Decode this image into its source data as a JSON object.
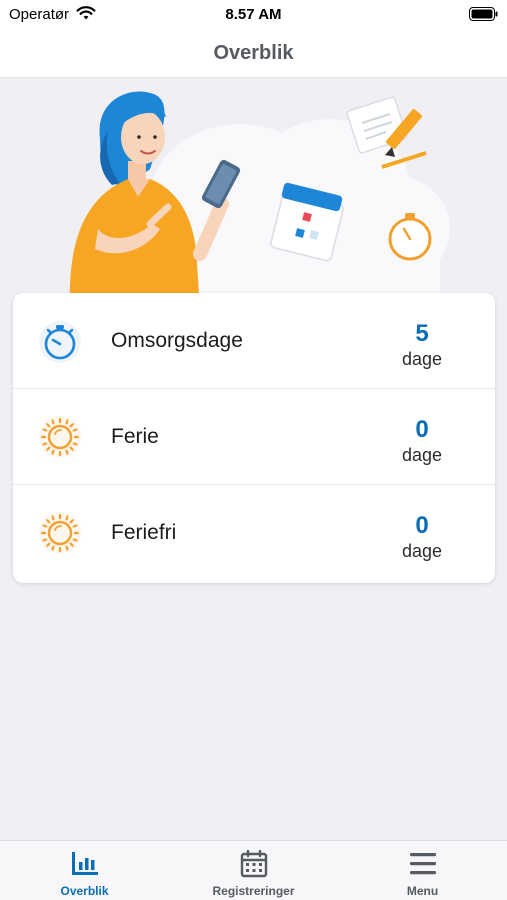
{
  "status_bar": {
    "carrier": "Operatør",
    "time": "8.57 AM",
    "wifi_icon": "wifi-icon",
    "battery_icon": "battery-full-icon"
  },
  "nav": {
    "title": "Overblik"
  },
  "hero": {
    "illustration": "woman-with-phone-calendar-stopwatch-illustration",
    "colors": {
      "hair": "#1d86d6",
      "shirt": "#f6a623",
      "cloud": "#f7f7f9"
    }
  },
  "overview": {
    "items": [
      {
        "label": "Omsorgsdage",
        "value": "5",
        "unit": "dage",
        "icon": "stopwatch-icon"
      },
      {
        "label": "Ferie",
        "value": "0",
        "unit": "dage",
        "icon": "sun-icon"
      },
      {
        "label": "Feriefri",
        "value": "0",
        "unit": "dage",
        "icon": "sun-icon"
      }
    ],
    "value_color": "#0a6eb4",
    "icon_color_stopwatch": "#1d86d6",
    "icon_color_sun": "#f0a030"
  },
  "tabs": [
    {
      "label": "Overblik",
      "icon": "bar-chart-icon",
      "active": true
    },
    {
      "label": "Registreringer",
      "icon": "calendar-icon",
      "active": false
    },
    {
      "label": "Menu",
      "icon": "hamburger-menu-icon",
      "active": false
    }
  ],
  "colors": {
    "accent": "#0a6eb4",
    "background": "#efeff4",
    "tab_inactive": "#555b61"
  }
}
